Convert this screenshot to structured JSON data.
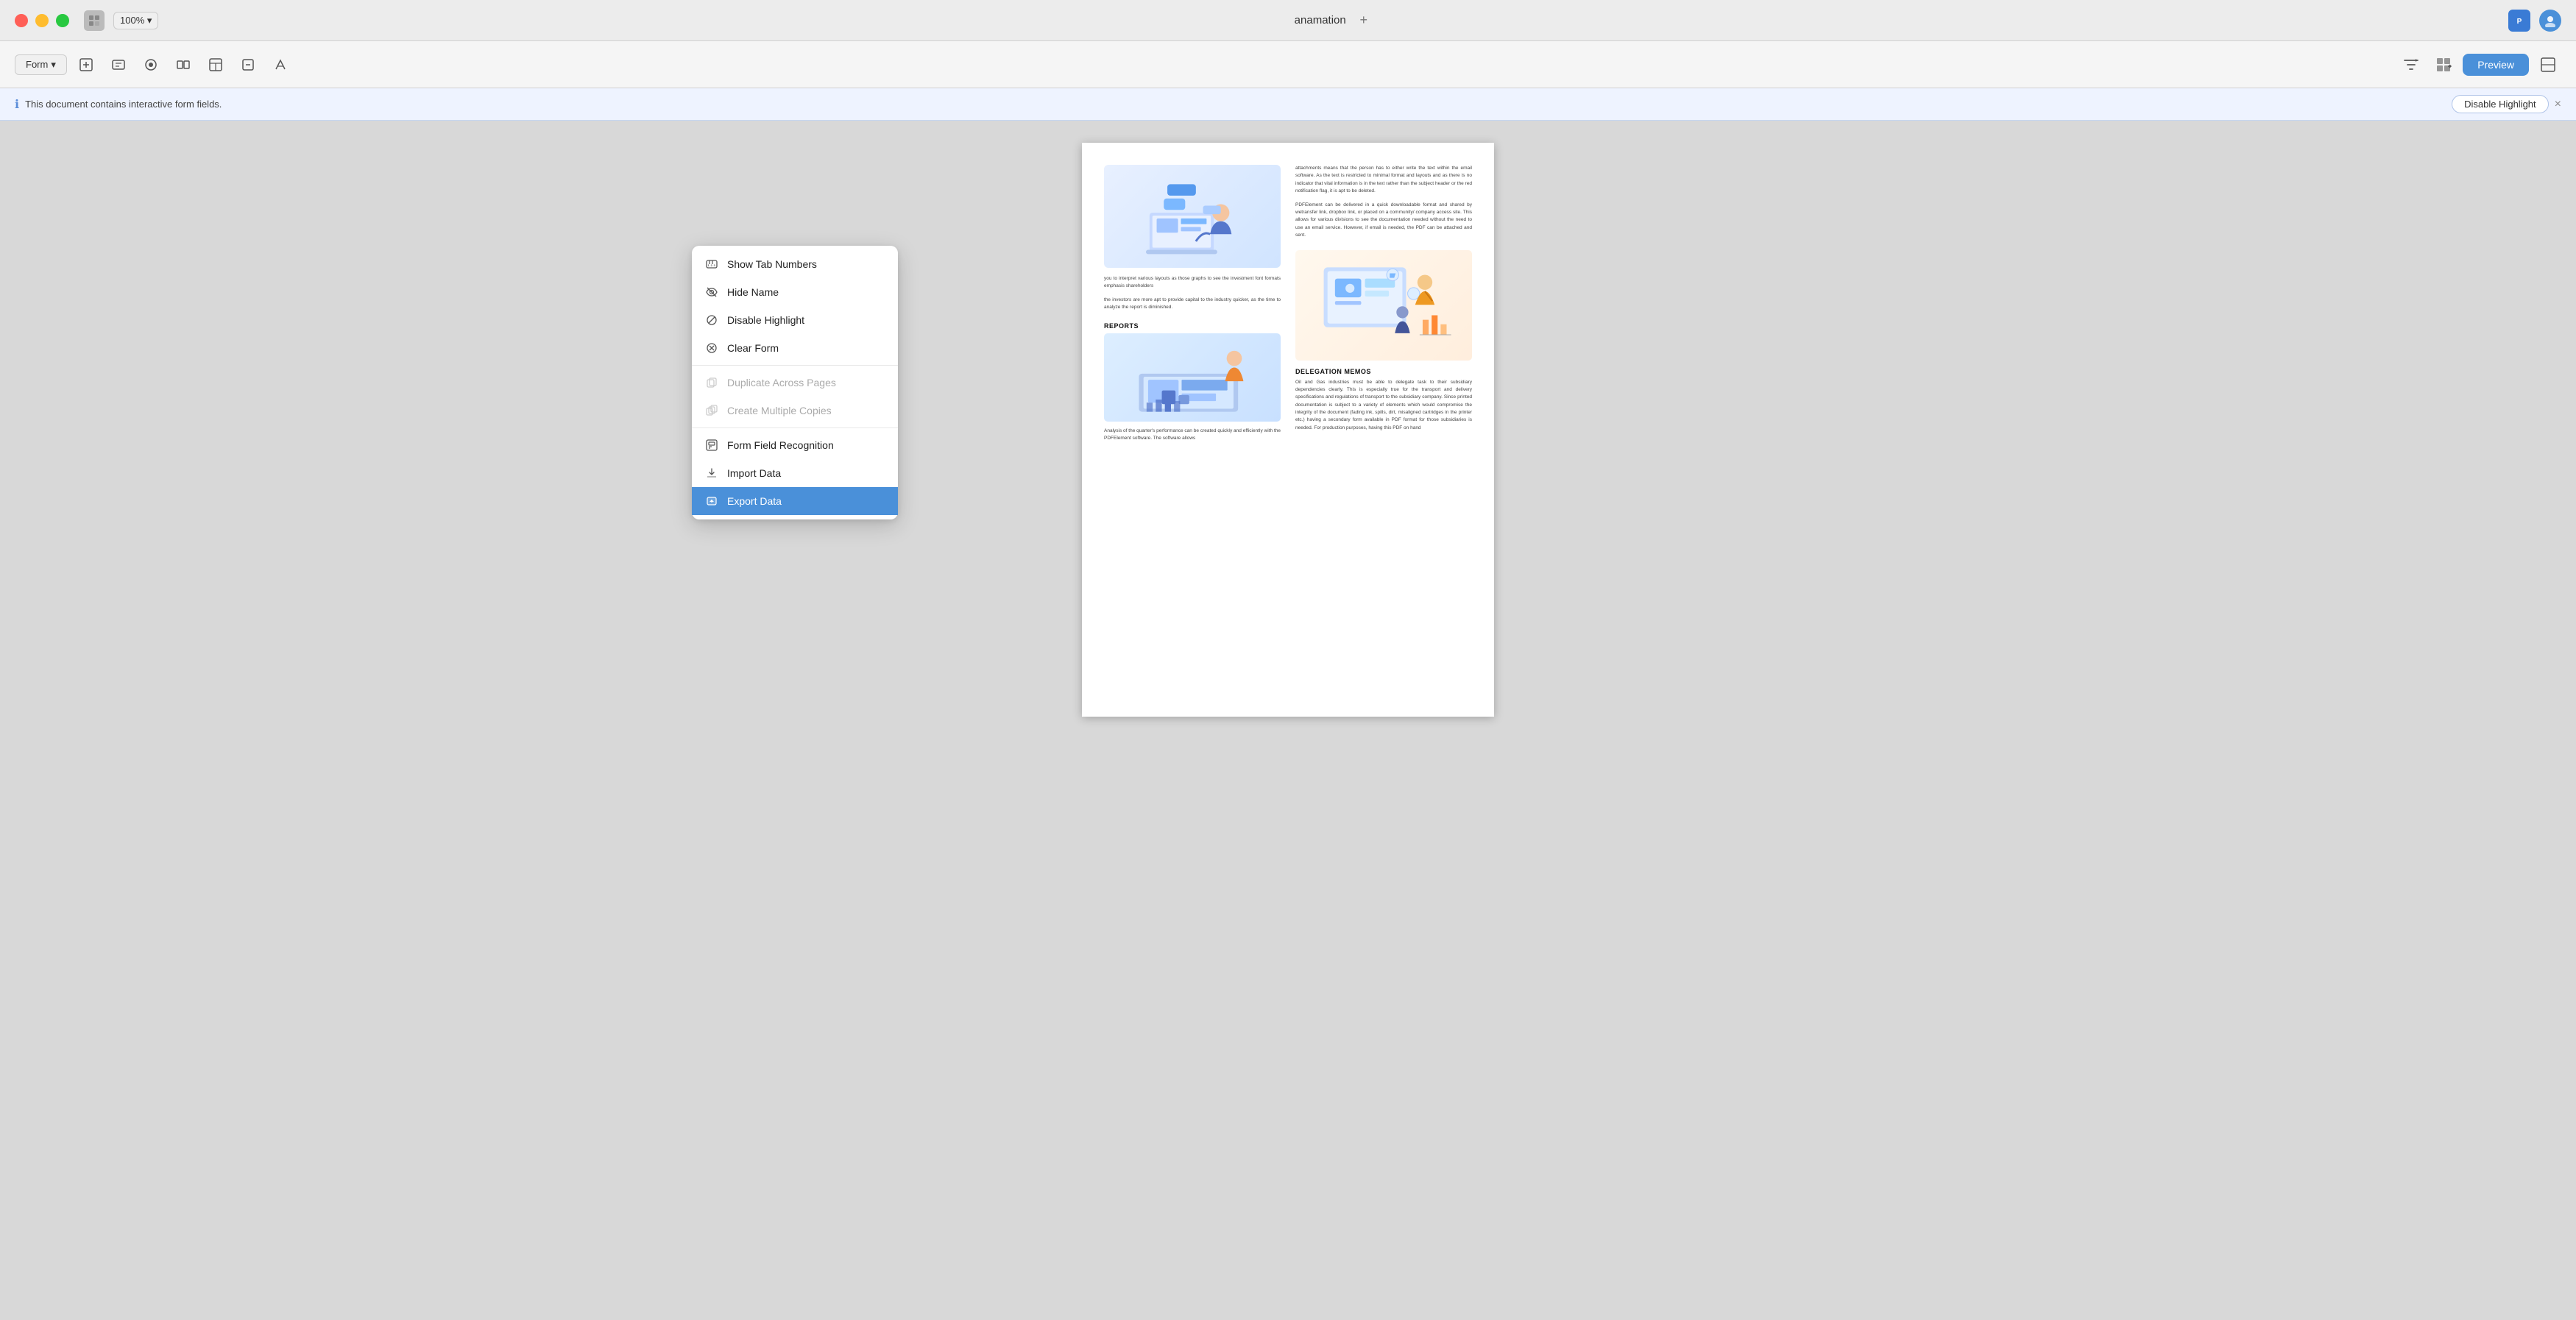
{
  "titlebar": {
    "app_name": "anamation",
    "tab_add": "+",
    "zoom_level": "100%"
  },
  "toolbar": {
    "form_button_label": "Form",
    "preview_button_label": "Preview",
    "form_chevron": "▾"
  },
  "infobar": {
    "message": "This document contains interactive form fields.",
    "disable_highlight": "Disable Highlight",
    "close_label": "×"
  },
  "dropdown_menu": {
    "items": [
      {
        "id": "show-tab-numbers",
        "label": "Show Tab Numbers",
        "icon": "tab",
        "disabled": false,
        "active": false
      },
      {
        "id": "hide-name",
        "label": "Hide Name",
        "icon": "eye-slash",
        "disabled": false,
        "active": false
      },
      {
        "id": "disable-highlight",
        "label": "Disable Highlight",
        "icon": "no-entry",
        "disabled": false,
        "active": false
      },
      {
        "id": "clear-form",
        "label": "Clear Form",
        "icon": "clear",
        "disabled": false,
        "active": false
      },
      {
        "id": "duplicate-across-pages",
        "label": "Duplicate Across Pages",
        "icon": "duplicate",
        "disabled": true,
        "active": false
      },
      {
        "id": "create-multiple-copies",
        "label": "Create Multiple Copies",
        "icon": "copy",
        "disabled": true,
        "active": false
      },
      {
        "id": "form-field-recognition",
        "label": "Form Field Recognition",
        "icon": "recognition",
        "disabled": false,
        "active": false
      },
      {
        "id": "import-data",
        "label": "Import Data",
        "icon": "import",
        "disabled": false,
        "active": false
      },
      {
        "id": "export-data",
        "label": "Export Data",
        "icon": "export",
        "disabled": false,
        "active": true
      }
    ]
  },
  "pdf": {
    "section_reports": "REPORTS",
    "section_delegation": "DELEGATION MEMOS",
    "body_text_1": "you to interpret various layouts as those graphs to see the investment font formats emphasis shareholders",
    "body_text_2": "the investors are more apt to provide capital to the industry quicker, as the time to analyze the report is diminished.",
    "body_text_3": "attachments means that the person has to either write the text within the email software. As the text is restricted to minimal format and layouts and as there is no indicator that vital information is in the text rather than the subject header or the red notification flag, it is apt to be deleted.",
    "body_text_4": "PDFElement can be delivered in a quick downloadable format and shared by wetransfer link, dropbox link, or placed on a community/ company access site. This allows for various divisions to see the documentation needed without the need to use an email service. However, if email is needed, the PDF can be attached and sent.",
    "body_text_5": "Analysis of the quarter's performance can be created quickly and efficiently with the PDFElement software. The software allows",
    "body_text_6": "Oil and Gas industries must be able to delegate task to their subsidiary dependencies clearly. This is especially true for the transport and delivery specifications and regulations of transport to the subsidiary company. Since printed documentation is subject to a variety of elements which would compromise the integrity of the document (fading ink, spills, dirt, misaligned cartridges in the printer etc.) having a secondary form available in PDF format for those subsidiaries is needed. For production purposes, having this PDF on hand"
  },
  "colors": {
    "accent_blue": "#4a90d9",
    "menu_active_bg": "#4a90d9",
    "infobar_bg": "#eef3ff",
    "disabled_text": "#aaaaaa"
  },
  "icons": {
    "tab": "⇥",
    "eye_slash": "👁",
    "no_entry": "⊘",
    "clear": "⊗",
    "duplicate": "⊡",
    "copy": "⊞",
    "recognition": "⊟",
    "import": "⤵",
    "export": "⤴",
    "info": "ℹ",
    "close": "×",
    "chevron_down": "▾",
    "preview": "▶",
    "grid": "⊞"
  }
}
